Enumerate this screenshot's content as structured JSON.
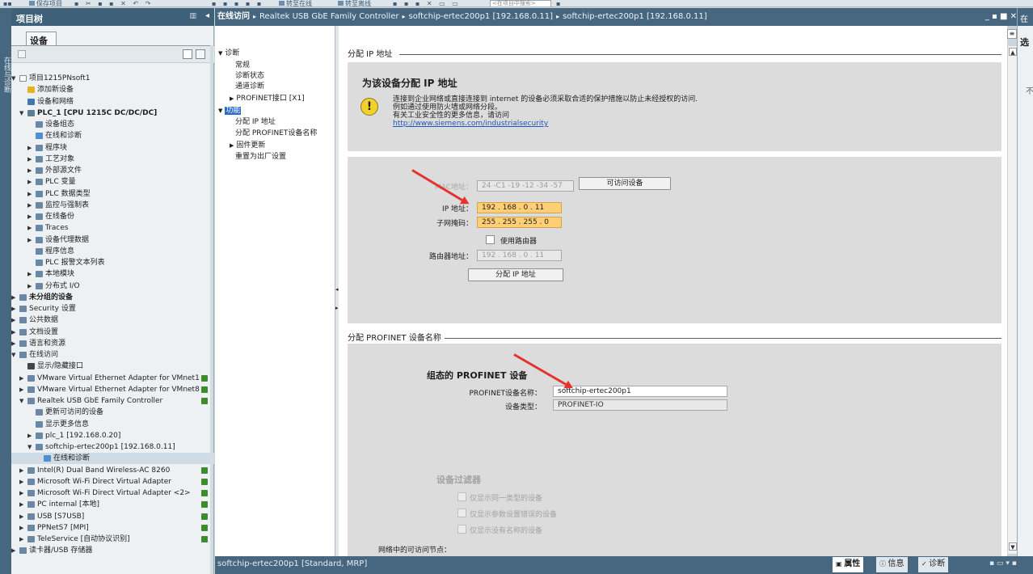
{
  "toolbar": {
    "items": [
      "保存项目",
      "转至在线",
      "转至离线"
    ],
    "search_placeholder": "<在项目中搜索>"
  },
  "left_strip": {
    "label": "在线与诊断"
  },
  "project_tree": {
    "title": "项目树",
    "tab": "设备",
    "rows": [
      {
        "label": "项目1215PNsoft1",
        "expand": "▼",
        "icon": "project-icon",
        "color": "#ffffff"
      },
      {
        "label": "添加新设备",
        "expand": "",
        "icon": "add-device-icon",
        "color": "#e6b31a"
      },
      {
        "label": "设备和网络",
        "expand": "",
        "icon": "network-icon",
        "color": "#3f78ad"
      },
      {
        "label": "PLC_1 [CPU 1215C DC/DC/DC]",
        "expand": "▼",
        "icon": "plc-icon",
        "color": "#5d7c95",
        "bold": true
      },
      {
        "label": "设备组态",
        "expand": "",
        "icon": "device-config-icon",
        "color": "#6a88a3"
      },
      {
        "label": "在线和诊断",
        "expand": "",
        "icon": "diagnostics-icon",
        "color": "#4e8fd0"
      },
      {
        "label": "程序块",
        "expand": "▶",
        "icon": "folder-icon",
        "color": "#6a88a3"
      },
      {
        "label": "工艺对象",
        "expand": "▶",
        "icon": "folder-icon",
        "color": "#6a88a3"
      },
      {
        "label": "外部源文件",
        "expand": "▶",
        "icon": "folder-icon",
        "color": "#6a88a3"
      },
      {
        "label": "PLC 变量",
        "expand": "▶",
        "icon": "folder-icon",
        "color": "#6a88a3"
      },
      {
        "label": "PLC 数据类型",
        "expand": "▶",
        "icon": "folder-icon",
        "color": "#6a88a3"
      },
      {
        "label": "监控与强制表",
        "expand": "▶",
        "icon": "folder-icon",
        "color": "#6a88a3"
      },
      {
        "label": "在线备份",
        "expand": "▶",
        "icon": "folder-icon",
        "color": "#6a88a3"
      },
      {
        "label": "Traces",
        "expand": "▶",
        "icon": "folder-icon",
        "color": "#6a88a3"
      },
      {
        "label": "设备代理数据",
        "expand": "▶",
        "icon": "folder-icon",
        "color": "#6a88a3"
      },
      {
        "label": "程序信息",
        "expand": "",
        "icon": "program-info-icon",
        "color": "#6a88a3"
      },
      {
        "label": "PLC 报警文本列表",
        "expand": "",
        "icon": "alarm-list-icon",
        "color": "#6a88a3"
      },
      {
        "label": "本地模块",
        "expand": "▶",
        "icon": "folder-icon",
        "color": "#6a88a3"
      },
      {
        "label": "分布式 I/O",
        "expand": "▶",
        "icon": "folder-icon",
        "color": "#6a88a3"
      },
      {
        "label": "未分组的设备",
        "expand": "▶",
        "icon": "folder-icon",
        "color": "#6a88a3",
        "bold": true
      },
      {
        "label": "Security 设置",
        "expand": "▶",
        "icon": "security-icon",
        "color": "#6a88a3"
      },
      {
        "label": "公共数据",
        "expand": "▶",
        "icon": "folder-icon",
        "color": "#6a88a3"
      },
      {
        "label": "文档设置",
        "expand": "▶",
        "icon": "folder-icon",
        "color": "#6a88a3"
      },
      {
        "label": "语言和资源",
        "expand": "▶",
        "icon": "folder-icon",
        "color": "#6a88a3"
      },
      {
        "label": "在线访问",
        "expand": "▼",
        "icon": "online-access-icon",
        "color": "#6a88a3"
      },
      {
        "label": "显示/隐藏接口",
        "expand": "",
        "icon": "filter-icon",
        "color": "#444444"
      },
      {
        "label": "VMware Virtual Ethernet Adapter for VMnet1",
        "expand": "▶",
        "icon": "adapter-icon",
        "color": "#6a88a3",
        "status": true
      },
      {
        "label": "VMware Virtual Ethernet Adapter for VMnet8",
        "expand": "▶",
        "icon": "adapter-icon",
        "color": "#6a88a3",
        "status": true
      },
      {
        "label": "Realtek USB GbE Family Controller",
        "expand": "▼",
        "icon": "adapter-icon",
        "color": "#6a88a3",
        "status": true
      },
      {
        "label": "更新可访问的设备",
        "expand": "",
        "icon": "update-icon",
        "color": "#6a88a3"
      },
      {
        "label": "显示更多信息",
        "expand": "",
        "icon": "info-icon",
        "color": "#6a88a3"
      },
      {
        "label": "plc_1 [192.168.0.20]",
        "expand": "▶",
        "icon": "device-icon",
        "color": "#6a88a3"
      },
      {
        "label": "softchip-ertec200p1 [192.168.0.11]",
        "expand": "▼",
        "icon": "device-icon",
        "color": "#6a88a3"
      },
      {
        "label": "在线和诊断",
        "expand": "",
        "icon": "diagnostics-icon",
        "color": "#4e8fd0",
        "selected": true
      },
      {
        "label": "Intel(R) Dual Band Wireless-AC 8260",
        "expand": "▶",
        "icon": "adapter-icon",
        "color": "#6a88a3",
        "status": true
      },
      {
        "label": "Microsoft Wi-Fi Direct Virtual Adapter",
        "expand": "▶",
        "icon": "adapter-icon",
        "color": "#6a88a3",
        "status": true
      },
      {
        "label": "Microsoft Wi-Fi Direct Virtual Adapter <2>",
        "expand": "▶",
        "icon": "adapter-icon",
        "color": "#6a88a3",
        "status": true
      },
      {
        "label": "PC internal [本地]",
        "expand": "▶",
        "icon": "adapter-icon",
        "color": "#6a88a3",
        "status": true
      },
      {
        "label": "USB [S7USB]",
        "expand": "▶",
        "icon": "adapter-icon",
        "color": "#6a88a3",
        "status": true
      },
      {
        "label": "PPNetS7 [MPI]",
        "expand": "▶",
        "icon": "adapter-icon",
        "color": "#6a88a3",
        "status": true
      },
      {
        "label": "TeleService [自动协议识别]",
        "expand": "▶",
        "icon": "adapter-icon",
        "color": "#6a88a3",
        "status": true
      },
      {
        "label": "读卡器/USB 存储器",
        "expand": "▶",
        "icon": "card-reader-icon",
        "color": "#6a88a3"
      }
    ]
  },
  "breadcrumb": {
    "items": [
      "在线访问",
      "Realtek USB GbE Family Controller",
      "softchip-ertec200p1 [192.168.0.11]",
      "softchip-ertec200p1 [192.168.0.11]"
    ],
    "separator": "▸"
  },
  "nav": {
    "items": [
      {
        "label": "诊断",
        "expand": "▼"
      },
      {
        "label": "常规",
        "expand": ""
      },
      {
        "label": "诊断状态",
        "expand": ""
      },
      {
        "label": "通道诊断",
        "expand": ""
      },
      {
        "label": "PROFINET接口 [X1]",
        "expand": "▶"
      },
      {
        "label": "功能",
        "expand": "▼",
        "highlight": true
      },
      {
        "label": "分配 IP 地址",
        "expand": ""
      },
      {
        "label": "分配 PROFINET设备名称",
        "expand": ""
      },
      {
        "label": "固件更新",
        "expand": "▶"
      },
      {
        "label": "重置为出厂设置",
        "expand": ""
      }
    ]
  },
  "assign_ip": {
    "section_title": "分配 IP 地址",
    "heading": "为该设备分配 IP 地址",
    "warning_lines": [
      "连接到企业网络或直接连接到 internet 的设备必须采取合适的保护措施以防止未经授权的访问.",
      "例如通过使用防火墙或网络分段。",
      "有关工业安全性的更多信息，请访问"
    ],
    "link": "http://www.siemens.com/industrialsecurity",
    "mac_label": "MAC地址：",
    "mac_value": "24 -C1 -19 -12 -34 -57",
    "accessible_button": "可访问设备",
    "ip_label": "IP 地址：",
    "ip_value": "192 . 168 . 0  . 11",
    "subnet_label": "子网掩码：",
    "subnet_value": "255 . 255 . 255 . 0",
    "use_router_label": "使用路由器",
    "router_label": "路由器地址：",
    "router_value": "192 . 168 . 0  . 11",
    "assign_button": "分配 IP 地址"
  },
  "assign_name": {
    "section_title": "分配 PROFINET 设备名称",
    "heading": "组态的 PROFINET 设备",
    "name_label": "PROFINET设备名称：",
    "name_value": "softchip-ertec200p1",
    "type_label": "设备类型：",
    "type_value": "PROFINET-IO",
    "filter_heading": "设备过滤器",
    "filter_options": [
      "仅显示同一类型的设备",
      "仅显示参数设置错误的设备",
      "仅显示没有名称的设备"
    ],
    "network_nodes_label": "网络中的可访问节点："
  },
  "status_bar": {
    "device": "softchip-ertec200p1 [Standard, MRP]",
    "tabs": [
      "属性",
      "信息",
      "诊断"
    ]
  },
  "right_panel": {
    "header": "在",
    "tab": "选",
    "text": "不"
  },
  "colors": {
    "title_bar": "#46677f",
    "highlight_field": "#ffcf76",
    "arrow": "#e3322f"
  }
}
